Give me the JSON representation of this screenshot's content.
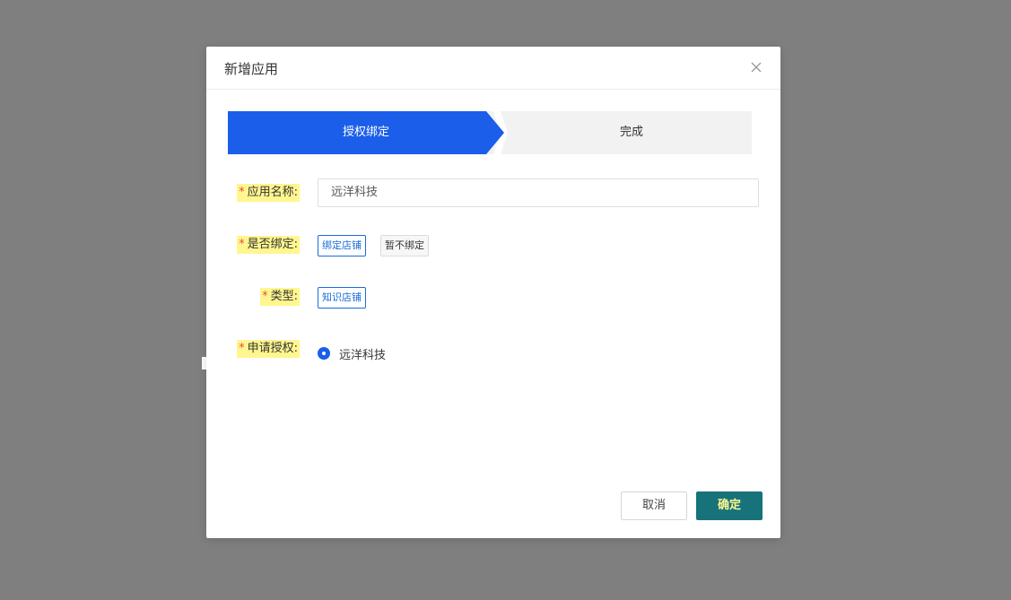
{
  "dialog": {
    "title": "新增应用"
  },
  "steps": [
    {
      "label": "授权绑定",
      "active": true
    },
    {
      "label": "完成",
      "active": false
    }
  ],
  "form": {
    "required_mark": "*",
    "app_name": {
      "label": "应用名称:",
      "value": "远洋科技"
    },
    "bind": {
      "label": "是否绑定:",
      "options": [
        "绑定店铺",
        "暂不绑定"
      ],
      "selected": "绑定店铺"
    },
    "type": {
      "label": "类型:",
      "options": [
        "知识店铺"
      ],
      "selected": "知识店铺"
    },
    "authorize": {
      "label": "申请授权:",
      "option": "远洋科技",
      "checked": true
    }
  },
  "footer": {
    "cancel_label": "取消",
    "ok_label": "确定"
  },
  "colors": {
    "primary": "#1a5eea",
    "ok_button": "#17727a",
    "highlight": "#fff68f",
    "required": "#e84d3d"
  }
}
